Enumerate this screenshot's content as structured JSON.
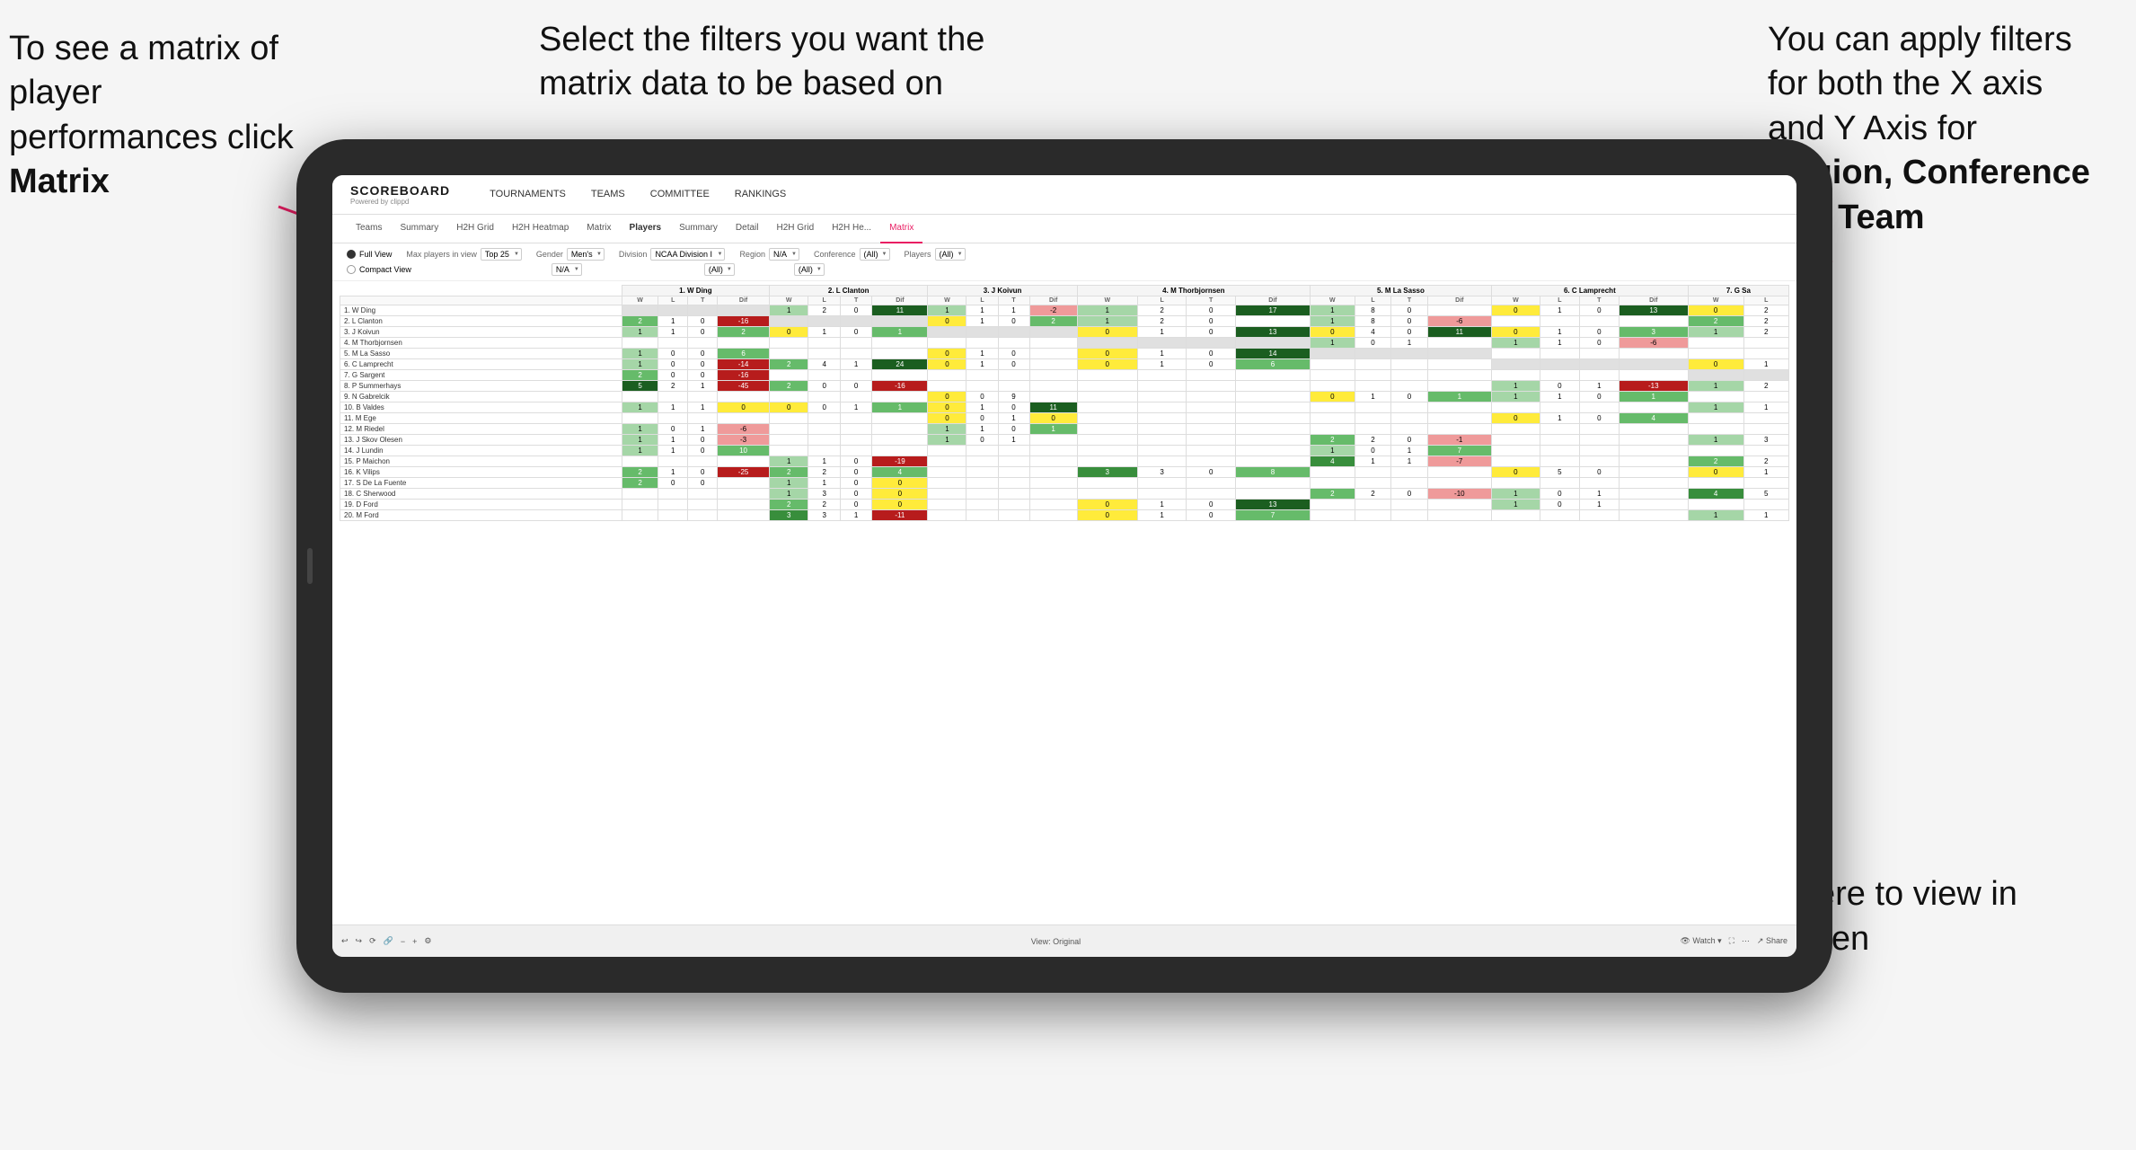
{
  "annotations": {
    "matrix_text": "To see a matrix of player performances click ",
    "matrix_bold": "Matrix",
    "filters_text": "Select the filters you want the matrix data to be based on",
    "axes_text": "You  can apply filters for both the X axis and Y Axis for ",
    "axes_bold": "Region, Conference and Team",
    "fullscreen_text": "Click here to view in full screen"
  },
  "nav": {
    "logo": "SCOREBOARD",
    "logo_sub": "Powered by clippd",
    "items": [
      "TOURNAMENTS",
      "TEAMS",
      "COMMITTEE",
      "RANKINGS"
    ]
  },
  "sub_tabs": {
    "players_tabs": [
      "Teams",
      "Summary",
      "H2H Grid",
      "H2H Heatmap",
      "Matrix",
      "Players",
      "Summary",
      "Detail",
      "H2H Grid",
      "H2H He...",
      "Matrix"
    ]
  },
  "filters": {
    "view_options": [
      "Full View",
      "Compact View"
    ],
    "max_players_label": "Max players in view",
    "max_players_value": "Top 25",
    "gender_label": "Gender",
    "gender_value": "Men's",
    "division_label": "Division",
    "division_value": "NCAA Division I",
    "region_label": "Region",
    "region_value": "N/A",
    "conference_label": "Conference",
    "conference_value": "(All)",
    "players_label": "Players",
    "players_value": "(All)"
  },
  "matrix_columns": [
    "1. W Ding",
    "2. L Clanton",
    "3. J Koivun",
    "4. M Thorbjornsen",
    "5. M La Sasso",
    "6. C Lamprecht",
    "7. G Sa"
  ],
  "matrix_rows": [
    "1. W Ding",
    "2. L Clanton",
    "3. J Koivun",
    "4. M Thorbjornsen",
    "5. M La Sasso",
    "6. C Lamprecht",
    "7. G Sargent",
    "8. P Summerhays",
    "9. N Gabrelcik",
    "10. B Valdes",
    "11. M Ege",
    "12. M Riedel",
    "13. J Skov Olesen",
    "14. J Lundin",
    "15. P Maichon",
    "16. K Vilips",
    "17. S De La Fuente",
    "18. C Sherwood",
    "19. D Ford",
    "20. M Ford"
  ],
  "toolbar": {
    "view_label": "View: Original",
    "watch_label": "Watch",
    "share_label": "Share"
  }
}
